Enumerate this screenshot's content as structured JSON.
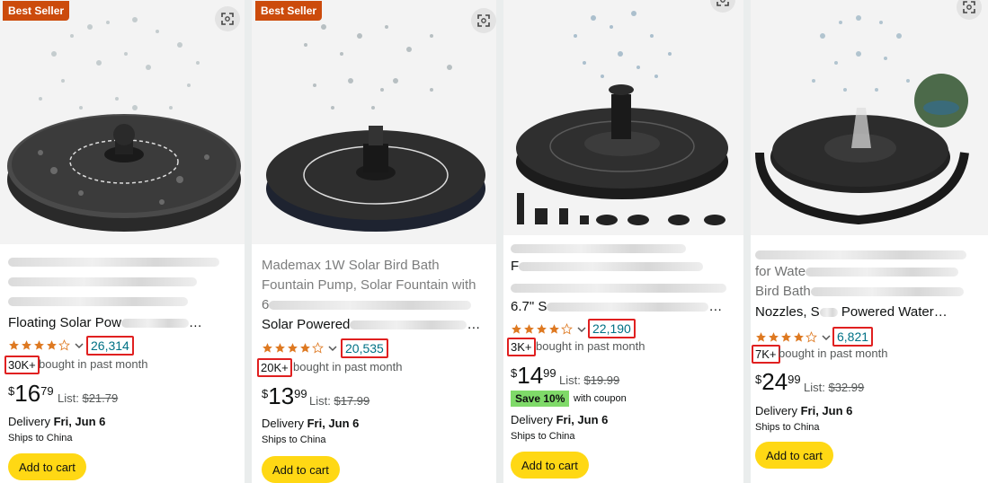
{
  "products": [
    {
      "badge": "Best Seller",
      "title_lines": [
        "",
        "",
        "",
        "Floating Solar Pow"
      ],
      "title_suffix": "…",
      "reviews": "26,314",
      "bought_count": "30K+",
      "bought_text": "bought in past month",
      "price_symbol": "$",
      "price_whole": "16",
      "price_fraction": "79",
      "list_label": "List:",
      "list_price": "$21.79",
      "delivery_label": "Delivery",
      "delivery_date": "Fri, Jun 6",
      "ships": "Ships to China",
      "cart_label": "Add to cart",
      "rating": 4.5
    },
    {
      "badge": "Best Seller",
      "title_lines": [
        "Mademax 1W Solar Bird Bath",
        "Fountain Pump, Solar Fountain with",
        "6",
        "Solar Powered"
      ],
      "title_suffix": "…",
      "reviews": "20,535",
      "bought_count": "20K+",
      "bought_text": "bought in past month",
      "price_symbol": "$",
      "price_whole": "13",
      "price_fraction": "99",
      "list_label": "List:",
      "list_price": "$17.99",
      "delivery_label": "Delivery",
      "delivery_date": "Fri, Jun 6",
      "ships": "Ships to China",
      "cart_label": "Add to cart",
      "rating": 4.5
    },
    {
      "title_lines": [
        "",
        "F",
        "",
        "6.7\" S"
      ],
      "title_suffix": "…",
      "reviews": "22,190",
      "bought_count": "3K+",
      "bought_text": "bought in past month",
      "price_symbol": "$",
      "price_whole": "14",
      "price_fraction": "99",
      "list_label": "List:",
      "list_price": "$19.99",
      "save_label": "Save 10%",
      "coupon_text": "with coupon",
      "delivery_label": "Delivery",
      "delivery_date": "Fri, Jun 6",
      "ships": "Ships to China",
      "cart_label": "Add to cart",
      "rating": 4.0
    },
    {
      "title_lines": [
        "",
        "for Wate",
        "Bird Bath",
        "Nozzles, S"
      ],
      "title_suffix": "Powered Water…",
      "reviews": "6,821",
      "bought_count": "7K+",
      "bought_text": "bought in past month",
      "price_symbol": "$",
      "price_whole": "24",
      "price_fraction": "99",
      "list_label": "List:",
      "list_price": "$32.99",
      "delivery_label": "Delivery",
      "delivery_date": "Fri, Jun 6",
      "ships": "Ships to China",
      "cart_label": "Add to cart",
      "rating": 4.0
    }
  ],
  "colors": {
    "badge": "#cc4b0c",
    "link": "#007185",
    "star": "#de7921",
    "highlight_box": "#e02020",
    "cart_button": "#ffd814",
    "save_badge": "#7fda69"
  },
  "icons": {
    "zoom": "expand-zoom-icon",
    "star": "star-icon",
    "chevron": "chevron-down-icon"
  }
}
